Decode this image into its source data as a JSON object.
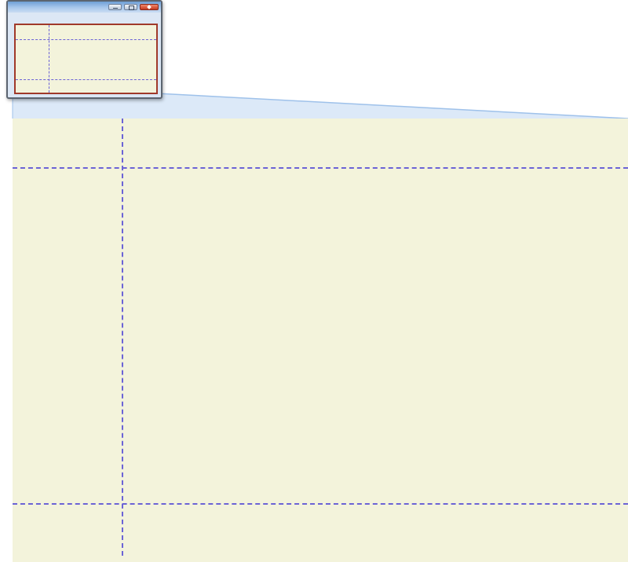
{
  "diagram": {
    "colors": {
      "page_background": "#f3f3db",
      "guide_line": "#6b63d6",
      "page_border": "#a0392a",
      "beam_fill": "#dce9f8",
      "beam_edge": "#9ec1ea",
      "window_frame": "#5b6470",
      "close_button": "#c63a20"
    },
    "thumbnail_window": {
      "icons": [
        "minimize-icon",
        "maximize-icon",
        "close-icon"
      ]
    }
  }
}
